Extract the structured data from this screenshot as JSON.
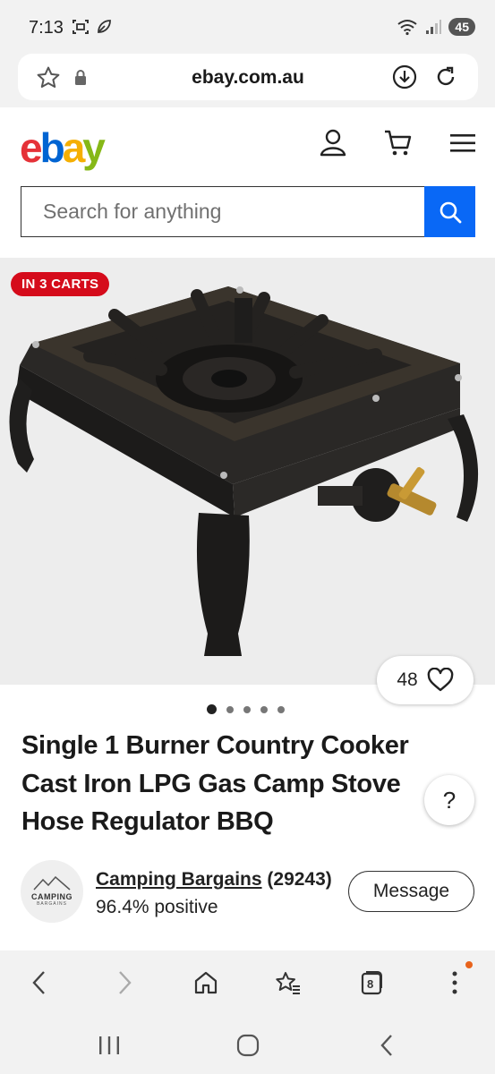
{
  "status_bar": {
    "time": "7:13",
    "battery": "45",
    "icons": [
      "screenshot-icon",
      "leaf-icon",
      "wifi-icon",
      "signal-icon"
    ]
  },
  "browser": {
    "url": "ebay.com.au",
    "bottom_nav": {
      "tabs_count": "8"
    }
  },
  "header": {
    "logo": {
      "e": "e",
      "b": "b",
      "a": "a",
      "y": "y"
    },
    "logo_colors": {
      "e": "#e53238",
      "b": "#0064d2",
      "a": "#f5af02",
      "y": "#86b817"
    },
    "search_placeholder": "Search for anything",
    "search_button_color": "#0968f6"
  },
  "listing": {
    "carts_badge": "IN 3 CARTS",
    "watch_count": "48",
    "image_count": 5,
    "active_image": 1,
    "title": "Single 1 Burner Country Cooker Cast Iron LPG Gas Camp Stove Hose Regulator BBQ",
    "help_label": "?"
  },
  "seller": {
    "avatar_text": "CAMPING",
    "avatar_subtext": "BARGAINS",
    "name": "Camping Bargains",
    "score": "(29243)",
    "feedback": "96.4% positive",
    "message_label": "Message"
  }
}
